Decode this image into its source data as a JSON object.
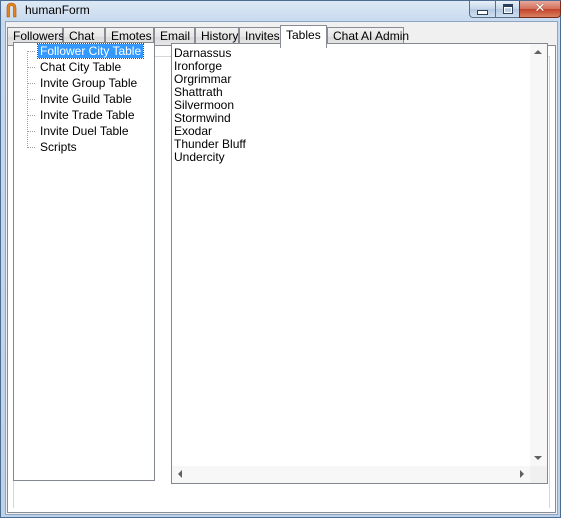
{
  "window": {
    "title": "humanForm",
    "icon": "app-logo-icon",
    "controls": [
      "minimize-icon",
      "maximize-icon",
      "close-icon"
    ]
  },
  "tabs": [
    {
      "label": "Followers",
      "active": false
    },
    {
      "label": "Chat",
      "active": false
    },
    {
      "label": "Emotes",
      "active": false
    },
    {
      "label": "Email",
      "active": false
    },
    {
      "label": "History",
      "active": false
    },
    {
      "label": "Invites",
      "active": false
    },
    {
      "label": "Tables",
      "active": true
    },
    {
      "label": "Chat AI Admin",
      "active": false
    }
  ],
  "tree": {
    "items": [
      {
        "label": "Follower City Table",
        "selected": true
      },
      {
        "label": "Chat City Table",
        "selected": false
      },
      {
        "label": "Invite Group Table",
        "selected": false
      },
      {
        "label": "Invite Guild Table",
        "selected": false
      },
      {
        "label": "Invite Trade Table",
        "selected": false
      },
      {
        "label": "Invite Duel Table",
        "selected": false
      },
      {
        "label": "Scripts",
        "selected": false
      }
    ]
  },
  "list": {
    "items": [
      "Darnassus",
      "Ironforge",
      "Orgrimmar",
      "Shattrath",
      "Silvermoon",
      "Stormwind",
      "Exodar",
      "Thunder Bluff",
      "Undercity"
    ]
  },
  "colors": {
    "selection": "#3399ff",
    "close_button": "#c2412a",
    "frame": "#c6d9ee"
  }
}
